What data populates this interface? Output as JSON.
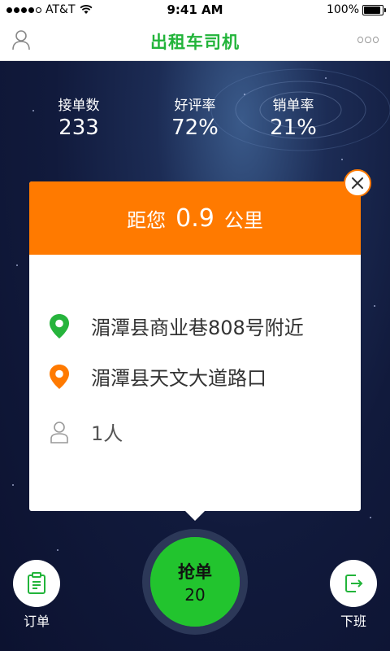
{
  "status_bar": {
    "carrier": "AT&T",
    "time": "9:41 AM",
    "battery": "100%",
    "battery_level": 1.0
  },
  "nav": {
    "title": "出租车司机",
    "left_icon": "user-icon",
    "right_icon": "more-icon"
  },
  "stats": [
    {
      "label": "接单数",
      "value": "233"
    },
    {
      "label": "好评率",
      "value": "72%"
    },
    {
      "label": "销单率",
      "value": "21%"
    }
  ],
  "order_card": {
    "distance_prefix": "距您",
    "distance_value": "0.9",
    "distance_unit": "公里",
    "pickup": "湄潭县商业巷808号附近",
    "destination": "湄潭县天文大道路口",
    "passengers": "1人"
  },
  "bottom": {
    "orders_label": "订单",
    "grab_label": "抢单",
    "grab_count": "20",
    "offduty_label": "下班"
  },
  "colors": {
    "brand_green": "#22b43a",
    "header_orange": "#ff7a00",
    "grab_green": "#22c42e",
    "background_navy": "#0e1634"
  }
}
